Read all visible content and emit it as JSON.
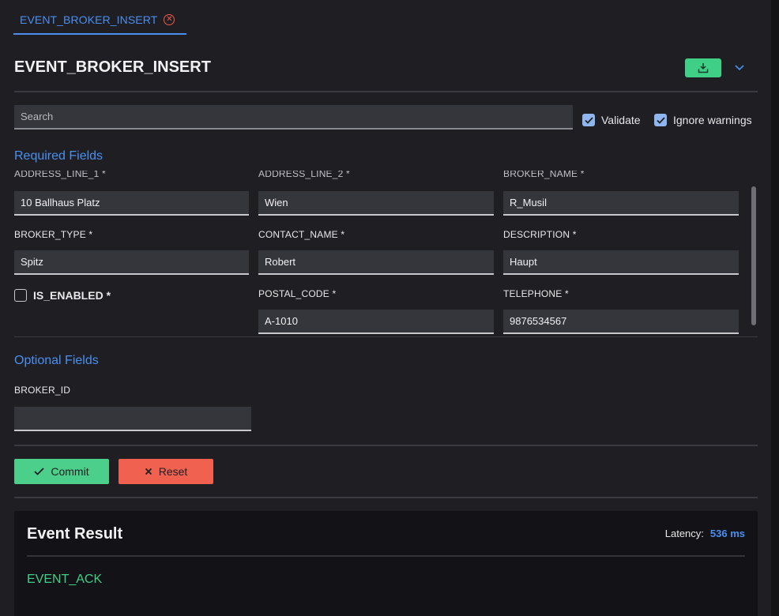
{
  "tab": {
    "label": "EVENT_BROKER_INSERT"
  },
  "header": {
    "title": "EVENT_BROKER_INSERT"
  },
  "search": {
    "placeholder": "Search"
  },
  "options": {
    "validate_label": "Validate",
    "ignore_warnings_label": "Ignore warnings"
  },
  "required": {
    "title": "Required Fields",
    "fields": [
      {
        "label": "ADDRESS_LINE_1 *",
        "value": "10 Ballhaus Platz"
      },
      {
        "label": "ADDRESS_LINE_2 *",
        "value": "Wien"
      },
      {
        "label": "BROKER_NAME *",
        "value": "R_Musil"
      },
      {
        "label": "BROKER_TYPE *",
        "value": "Spitz"
      },
      {
        "label": "CONTACT_NAME *",
        "value": "Robert"
      },
      {
        "label": "DESCRIPTION *",
        "value": "Haupt"
      },
      {
        "label": "IS_ENABLED *"
      },
      {
        "label": "POSTAL_CODE *",
        "value": "A-1010"
      },
      {
        "label": "TELEPHONE *",
        "value": "9876534567"
      }
    ]
  },
  "optional": {
    "title": "Optional Fields",
    "fields": [
      {
        "label": "BROKER_ID",
        "value": ""
      }
    ]
  },
  "actions": {
    "commit_label": "Commit",
    "reset_label": "Reset"
  },
  "result": {
    "title": "Event Result",
    "latency_label": "Latency:",
    "latency_value": "536 ms",
    "status": "EVENT_ACK"
  },
  "colors": {
    "accent": "#4a8ff0",
    "success": "#3fcf86",
    "danger": "#f0624f"
  },
  "icons": [
    "close-circle-icon",
    "download-icon",
    "chevron-down-icon",
    "check-icon",
    "x-icon"
  ]
}
